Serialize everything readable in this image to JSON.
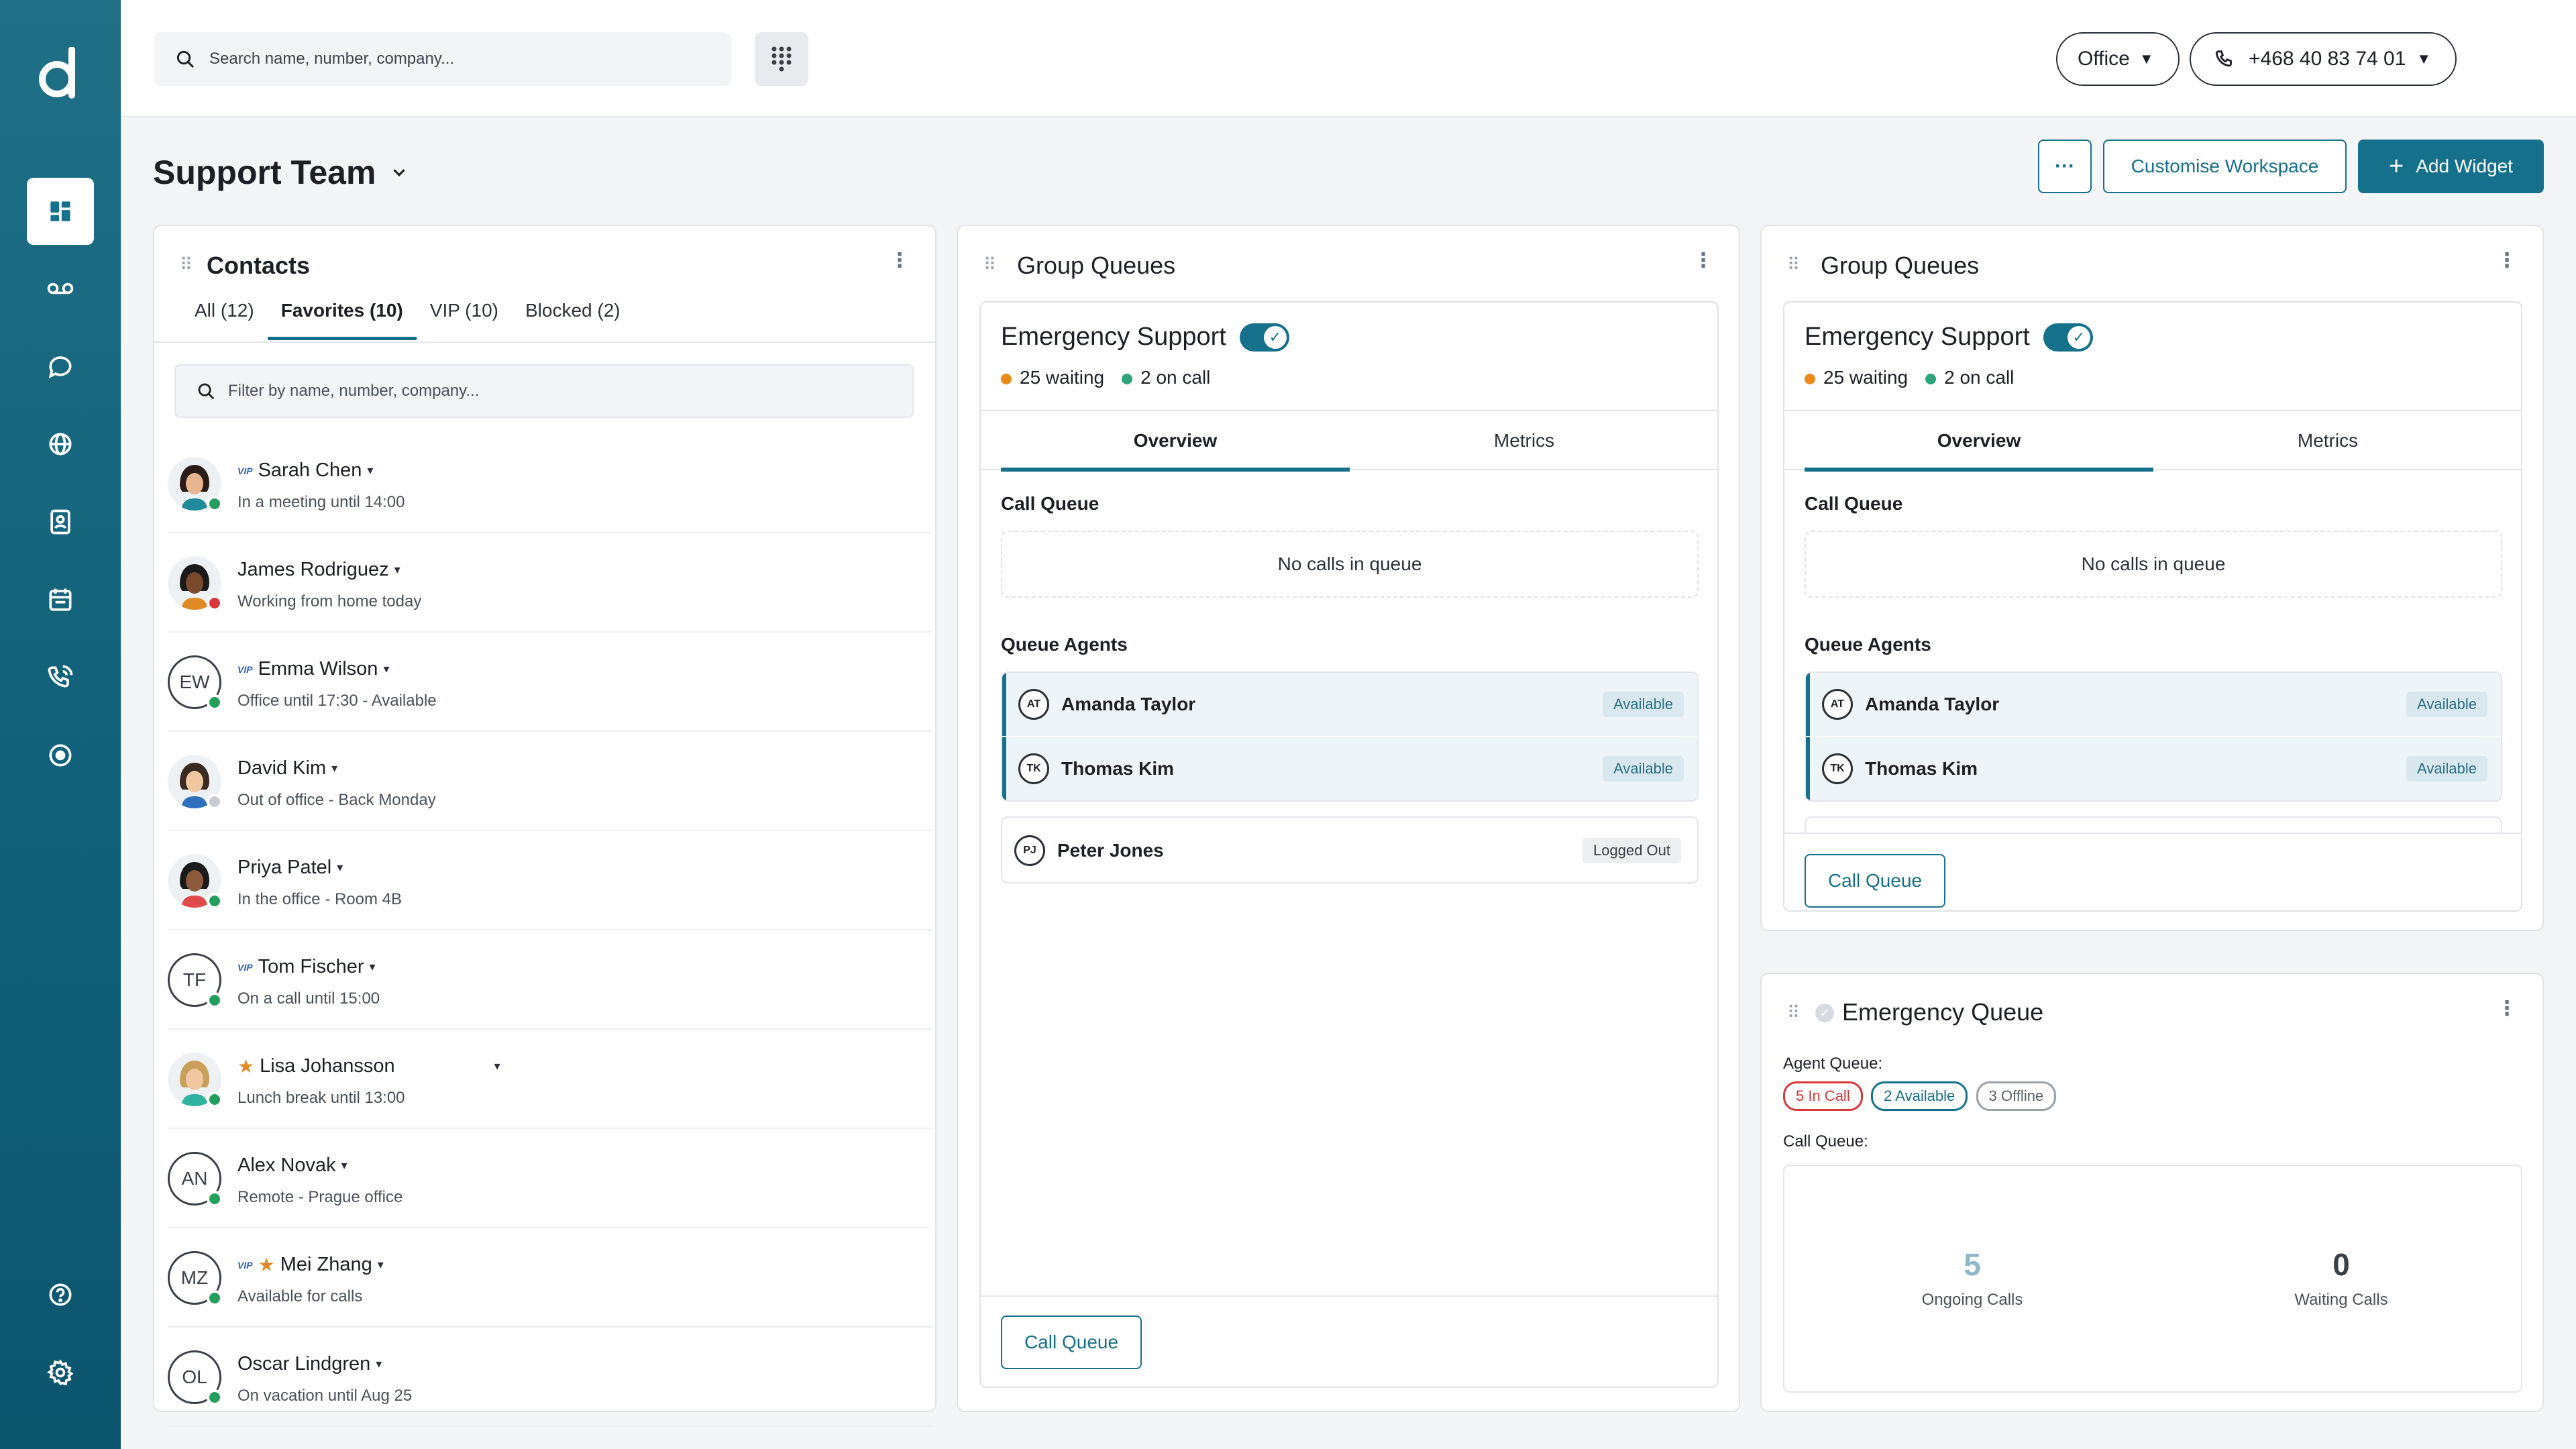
{
  "search": {
    "placeholder": "Search name, number, company..."
  },
  "topbar": {
    "office_label": "Office",
    "phone_number": "+468 40 83 74 01"
  },
  "page": {
    "title": "Support Team",
    "more_label": "···",
    "customise_label": "Customise Workspace",
    "add_widget_label": "Add Widget"
  },
  "contacts": {
    "title": "Contacts",
    "tabs": [
      {
        "label": "All (12)"
      },
      {
        "label": "Favorites (10)"
      },
      {
        "label": "VIP (10)"
      },
      {
        "label": "Blocked (2)"
      }
    ],
    "filter_placeholder": "Filter by name, number, company...",
    "items": [
      {
        "name": "Sarah Chen",
        "sub": "In a meeting until 14:00",
        "vip": "VIP",
        "initials": "",
        "status_color": "#22a05b"
      },
      {
        "name": "James Rodriguez",
        "sub": "Working from home today",
        "initials": "",
        "status_color": "#d9383a"
      },
      {
        "name": "Emma Wilson",
        "sub": "Office until 17:30 - Available",
        "vip": "VIP",
        "initials": "EW",
        "status_color": "#22a05b"
      },
      {
        "name": "David Kim",
        "sub": "Out of office - Back Monday",
        "initials": "",
        "status_color": "#c8ccd1"
      },
      {
        "name": "Priya Patel",
        "sub": "In the office - Room 4B",
        "initials": "",
        "status_color": "#22a05b"
      },
      {
        "name": "Tom Fischer",
        "sub": "On a call until 15:00",
        "vip": "VIP",
        "initials": "TF",
        "status_color": "#22a05b"
      },
      {
        "name": "Lisa Johansson",
        "sub": "Lunch break until 13:00",
        "star": "★",
        "initials": "",
        "status_color": "#22a05b"
      },
      {
        "name": "Alex Novak",
        "sub": "Remote - Prague office",
        "initials": "AN",
        "status_color": "#22a05b"
      },
      {
        "name": "Mei Zhang",
        "sub": "Available for calls",
        "vip": "VIP",
        "star": "★",
        "initials": "MZ",
        "status_color": "#22a05b"
      },
      {
        "name": "Oscar Lindgren",
        "sub": "On vacation until Aug 25",
        "initials": "OL",
        "status_color": "#22a05b"
      }
    ]
  },
  "group_queue_1": {
    "title": "Group Queues",
    "queue_name": "Emergency Support",
    "waiting": "25 waiting",
    "on_call": "2 on call",
    "tab_overview": "Overview",
    "tab_metrics": "Metrics",
    "call_queue_label": "Call Queue",
    "empty_label": "No calls in queue",
    "agents_label": "Queue Agents",
    "agents": [
      {
        "initials": "AT",
        "name": "Amanda Taylor",
        "status": "Available"
      },
      {
        "initials": "TK",
        "name": "Thomas Kim",
        "status": "Available"
      },
      {
        "initials": "PJ",
        "name": "Peter Jones",
        "status": "Logged Out"
      }
    ],
    "button_label": "Call Queue"
  },
  "group_queue_2": {
    "title": "Group Queues",
    "queue_name": "Emergency Support",
    "waiting": "25 waiting",
    "on_call": "2 on call",
    "tab_overview": "Overview",
    "tab_metrics": "Metrics",
    "call_queue_label": "Call Queue",
    "empty_label": "No calls in queue",
    "agents_label": "Queue Agents",
    "agents": [
      {
        "initials": "AT",
        "name": "Amanda Taylor",
        "status": "Available"
      },
      {
        "initials": "TK",
        "name": "Thomas Kim",
        "status": "Available"
      }
    ],
    "button_label": "Call Queue"
  },
  "emergency_queue": {
    "title": "Emergency Queue",
    "agent_queue_label": "Agent Queue:",
    "chip_in_call": "5 In Call",
    "chip_available": "2 Available",
    "chip_offline": "3 Offline",
    "call_queue_label": "Call Queue:",
    "ongoing_value": "5",
    "ongoing_label": "Ongoing Calls",
    "waiting_value": "0",
    "waiting_label": "Waiting Calls"
  },
  "colors": {
    "accent": "#15708b",
    "waiting_dot": "#e88a1a",
    "on_call_dot": "#2fa37a"
  }
}
